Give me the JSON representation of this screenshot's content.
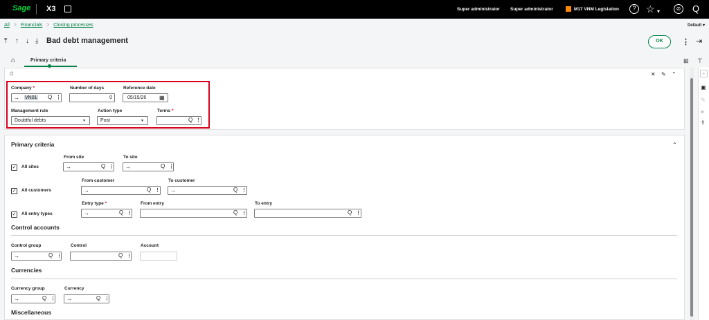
{
  "topbar": {
    "logo": "Sage",
    "product": "X3",
    "user1": "Super administrator",
    "user2": "Super administrator",
    "folder": "M17 VNM Legislation",
    "help_icon": "?",
    "star_icon": "☆",
    "chevron_icon": "▾",
    "compass_icon": "⊘",
    "search_icon": "Q"
  },
  "breadcrumb": {
    "all": "All",
    "sep": ">",
    "financials": "Financials",
    "closing": "Closing processes"
  },
  "default_label": "Default",
  "page_title": "Bad debt management",
  "ok_label": "OK",
  "tabs": {
    "primary": "Primary criteria"
  },
  "header_block": {
    "company_label": "Company",
    "company_value": "VN01",
    "days_label": "Number of days",
    "days_value": "0",
    "refdate_label": "Reference date",
    "refdate_value": "05/15/26",
    "rule_label": "Management rule",
    "rule_value": "Doubtful debts",
    "action_label": "Action type",
    "action_value": "Post",
    "terms_label": "Terms",
    "terms_value": ""
  },
  "primary": {
    "title": "Primary criteria",
    "from_site": "From site",
    "to_site": "To site",
    "all_sites": "All sites",
    "from_customer": "From customer",
    "to_customer": "To customer",
    "all_customers": "All customers",
    "entry_type": "Entry type",
    "from_entry": "From entry",
    "to_entry": "To entry",
    "all_entry_types": "All entry types",
    "control_accounts": "Control accounts",
    "control_group": "Control group",
    "control": "Control",
    "account": "Account",
    "currencies": "Currencies",
    "currency_group": "Currency group",
    "currency": "Currency",
    "misc": "Miscellaneous"
  },
  "required_mark": "*",
  "arrow": "→",
  "q": "Q",
  "dots": "⋮",
  "check": "✓",
  "caret": "▾"
}
